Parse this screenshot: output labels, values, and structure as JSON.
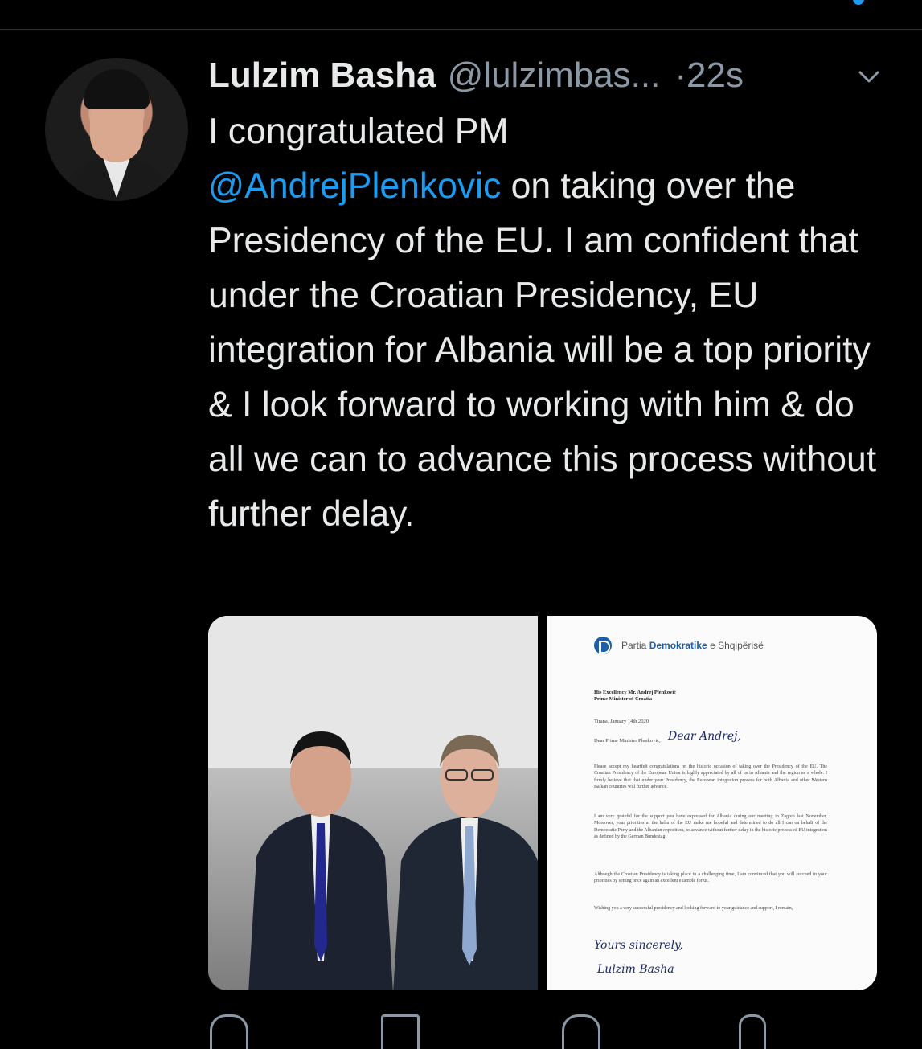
{
  "tweet": {
    "author_name": "Lulzim Basha",
    "author_handle": "@lulzimbas...",
    "timestamp": "·22s",
    "text_part1": "I congratulated PM",
    "mention": "@AndrejPlenkovic",
    "text_part2": " on taking over the Presidency of the EU. I am confident that under the Croatian Presidency, EU integration for Albania will be a top priority & I look forward to working with him & do all we can to advance this process without further delay."
  },
  "media": {
    "letter": {
      "party_prefix": "Partia ",
      "party_bold": "Demokratike",
      "party_suffix": " e Shqipërisë",
      "recipient_line1": "His Excellency Mr. Andrej Plenković",
      "recipient_line2": "Prime Minister of Croatia",
      "date": "Tirana, January 14th 2020",
      "salutation": "Dear Prime Minister Plenkovic,",
      "salutation_handwritten": "Dear Andrej,",
      "para1": "Please accept my heartfelt congratulations on the historic occasion of taking over the Presidency of the EU. The Croatian Presidency of the European Union is highly appreciated by all of us in Albania and the region as a whole. I firmly believe that that under your Presidency, the European integration process for both Albania and other Western Balkan countries will further advance.",
      "para2": "I am very grateful for the support you have expressed for Albania during our meeting in Zagreb last November. Moreover, your priorities at the helm of the EU make me hopeful and determined to do all I can on behalf of the Democratic Party and the Albanian opposition, to advance without further delay in the historic process of EU integration as defined by the German Bundestag.",
      "para3": "Although the Croatian Presidency is taking place in a challenging time, I am convinced that you will succeed in your priorities by setting once again an excellent example for us.",
      "para4": "Wishing you a very successful presidency and looking forward to your guidance and support, I remain,",
      "closing_handwritten": "Yours sincerely,",
      "signature_handwritten": "Lulzim Basha"
    }
  },
  "icons": {
    "avatar": "profile-photo",
    "caret": "chevron-down-icon",
    "actions": [
      "reply-icon",
      "retweet-icon",
      "like-icon",
      "share-icon"
    ]
  },
  "colors": {
    "background": "#000000",
    "text": "#e7e9ea",
    "secondary": "#8b98a5",
    "link": "#1d9bf0"
  }
}
